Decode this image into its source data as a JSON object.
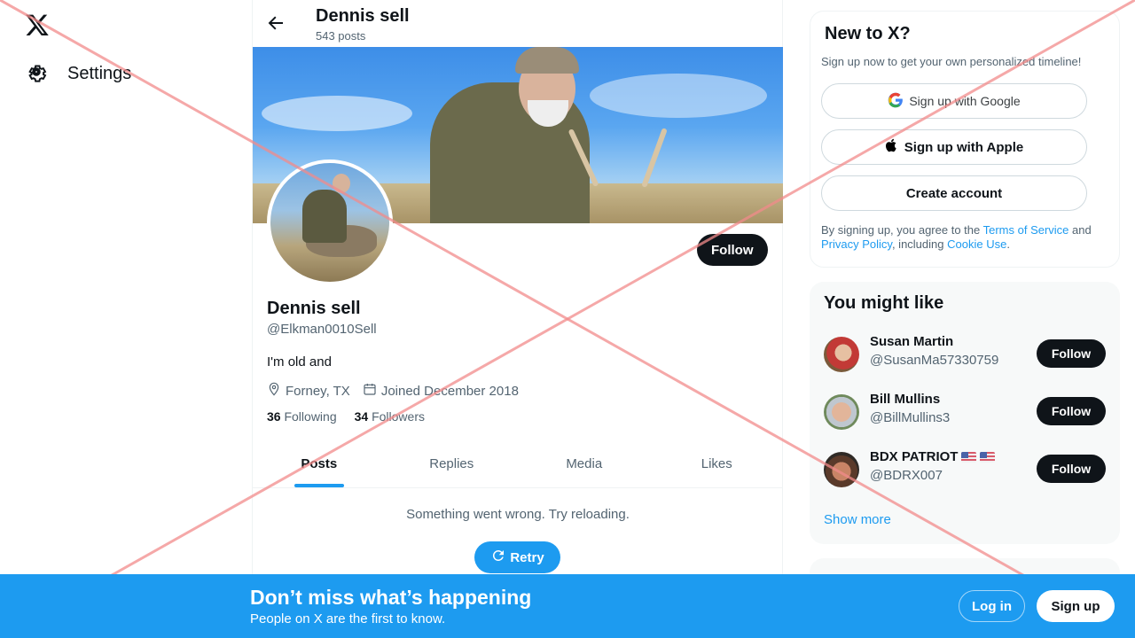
{
  "nav": {
    "logo_icon": "x-logo-icon",
    "settings_label": "Settings",
    "settings_icon": "gear-icon"
  },
  "profile_header": {
    "name": "Dennis sell",
    "post_count": "543 posts",
    "back_icon": "arrow-left-icon"
  },
  "profile": {
    "name": "Dennis sell",
    "handle": "@Elkman0010Sell",
    "bio": "I'm old and",
    "location": "Forney, TX",
    "joined": "Joined December 2018",
    "following_count": "36",
    "following_label": "Following",
    "followers_count": "34",
    "followers_label": "Followers",
    "follow_label": "Follow"
  },
  "tabs": [
    {
      "label": "Posts",
      "active": true
    },
    {
      "label": "Replies",
      "active": false
    },
    {
      "label": "Media",
      "active": false
    },
    {
      "label": "Likes",
      "active": false
    }
  ],
  "feed": {
    "error_text": "Something went wrong. Try reloading.",
    "retry_label": "Retry"
  },
  "new_to_x": {
    "title": "New to X?",
    "subtitle": "Sign up now to get your own personalized timeline!",
    "google_label": "Sign up with Google",
    "apple_label": "Sign up with Apple",
    "create_label": "Create account",
    "legal_prefix": "By signing up, you agree to the ",
    "terms_link": "Terms of Service",
    "legal_and": " and ",
    "privacy_link": "Privacy Policy",
    "legal_including": ", including ",
    "cookie_link": "Cookie Use",
    "legal_end": "."
  },
  "you_might_like": {
    "title": "You might like",
    "users": [
      {
        "name": "Susan Martin",
        "handle": "@SusanMa57330759",
        "follow_label": "Follow",
        "flags": 0
      },
      {
        "name": "Bill Mullins",
        "handle": "@BillMullins3",
        "follow_label": "Follow",
        "flags": 0
      },
      {
        "name": "BDX PATRIOT",
        "handle": "@BDRX007",
        "follow_label": "Follow",
        "flags": 2
      }
    ],
    "show_more": "Show more"
  },
  "bottom_bar": {
    "title": "Don’t miss what’s happening",
    "subtitle": "People on X are the first to know.",
    "login_label": "Log in",
    "signup_label": "Sign up"
  },
  "colors": {
    "accent": "#1d9bf0",
    "primary_button": "#0f1419",
    "secondary_text": "#536471",
    "overlay_x": "#f28b8b"
  }
}
